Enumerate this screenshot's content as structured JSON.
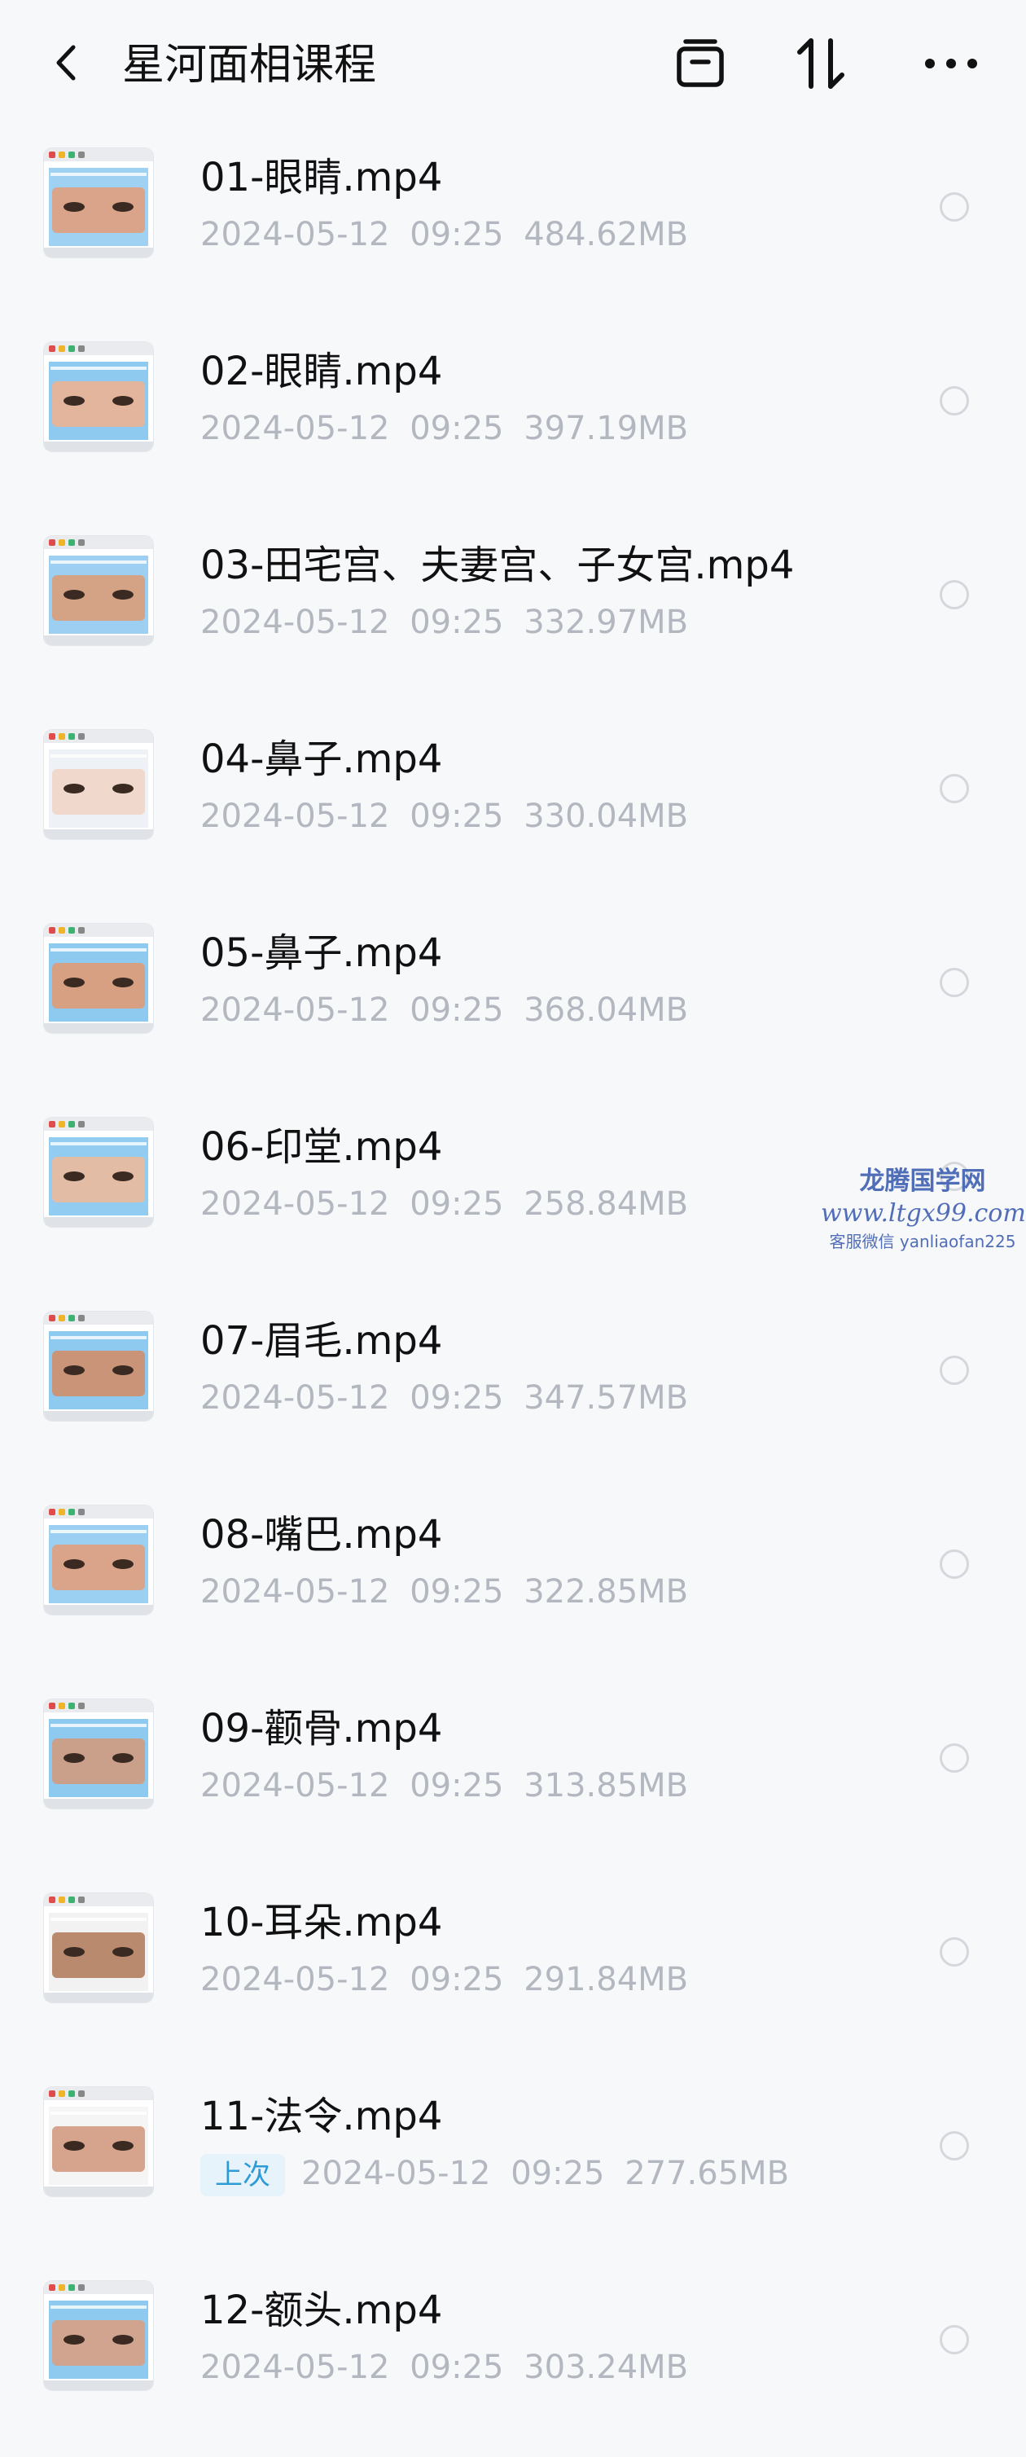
{
  "header": {
    "title": "星河面相课程",
    "back_icon": "chevron-left-icon",
    "actions": [
      "archive-icon",
      "sort-icon",
      "more-icon"
    ]
  },
  "files": [
    {
      "name": "01-眼睛.mp4",
      "date": "2024-05-12",
      "time": "09:25",
      "size": "484.62MB"
    },
    {
      "name": "02-眼睛.mp4",
      "date": "2024-05-12",
      "time": "09:25",
      "size": "397.19MB"
    },
    {
      "name": "03-田宅宫、夫妻宫、子女宫.mp4",
      "date": "2024-05-12",
      "time": "09:25",
      "size": "332.97MB"
    },
    {
      "name": "04-鼻子.mp4",
      "date": "2024-05-12",
      "time": "09:25",
      "size": "330.04MB"
    },
    {
      "name": "05-鼻子.mp4",
      "date": "2024-05-12",
      "time": "09:25",
      "size": "368.04MB"
    },
    {
      "name": "06-印堂.mp4",
      "date": "2024-05-12",
      "time": "09:25",
      "size": "258.84MB"
    },
    {
      "name": "07-眉毛.mp4",
      "date": "2024-05-12",
      "time": "09:25",
      "size": "347.57MB"
    },
    {
      "name": "08-嘴巴.mp4",
      "date": "2024-05-12",
      "time": "09:25",
      "size": "322.85MB"
    },
    {
      "name": "09-颧骨.mp4",
      "date": "2024-05-12",
      "time": "09:25",
      "size": "313.85MB"
    },
    {
      "name": "10-耳朵.mp4",
      "date": "2024-05-12",
      "time": "09:25",
      "size": "291.84MB"
    },
    {
      "name": "11-法令.mp4",
      "date": "2024-05-12",
      "time": "09:25",
      "size": "277.65MB",
      "badge": "上次"
    },
    {
      "name": "12-额头.mp4",
      "date": "2024-05-12",
      "time": "09:25",
      "size": "303.24MB"
    }
  ],
  "watermark": {
    "line1": "龙腾国学网",
    "line2": "www.ltgx99.com",
    "line3": "客服微信 yanliaofan225"
  },
  "colors": {
    "background": "#f7f8fa",
    "meta_text": "#b3b7bf",
    "badge_text": "#2e9ad6",
    "badge_bg": "#e7f3fb",
    "watermark": "#3a5bb0"
  }
}
